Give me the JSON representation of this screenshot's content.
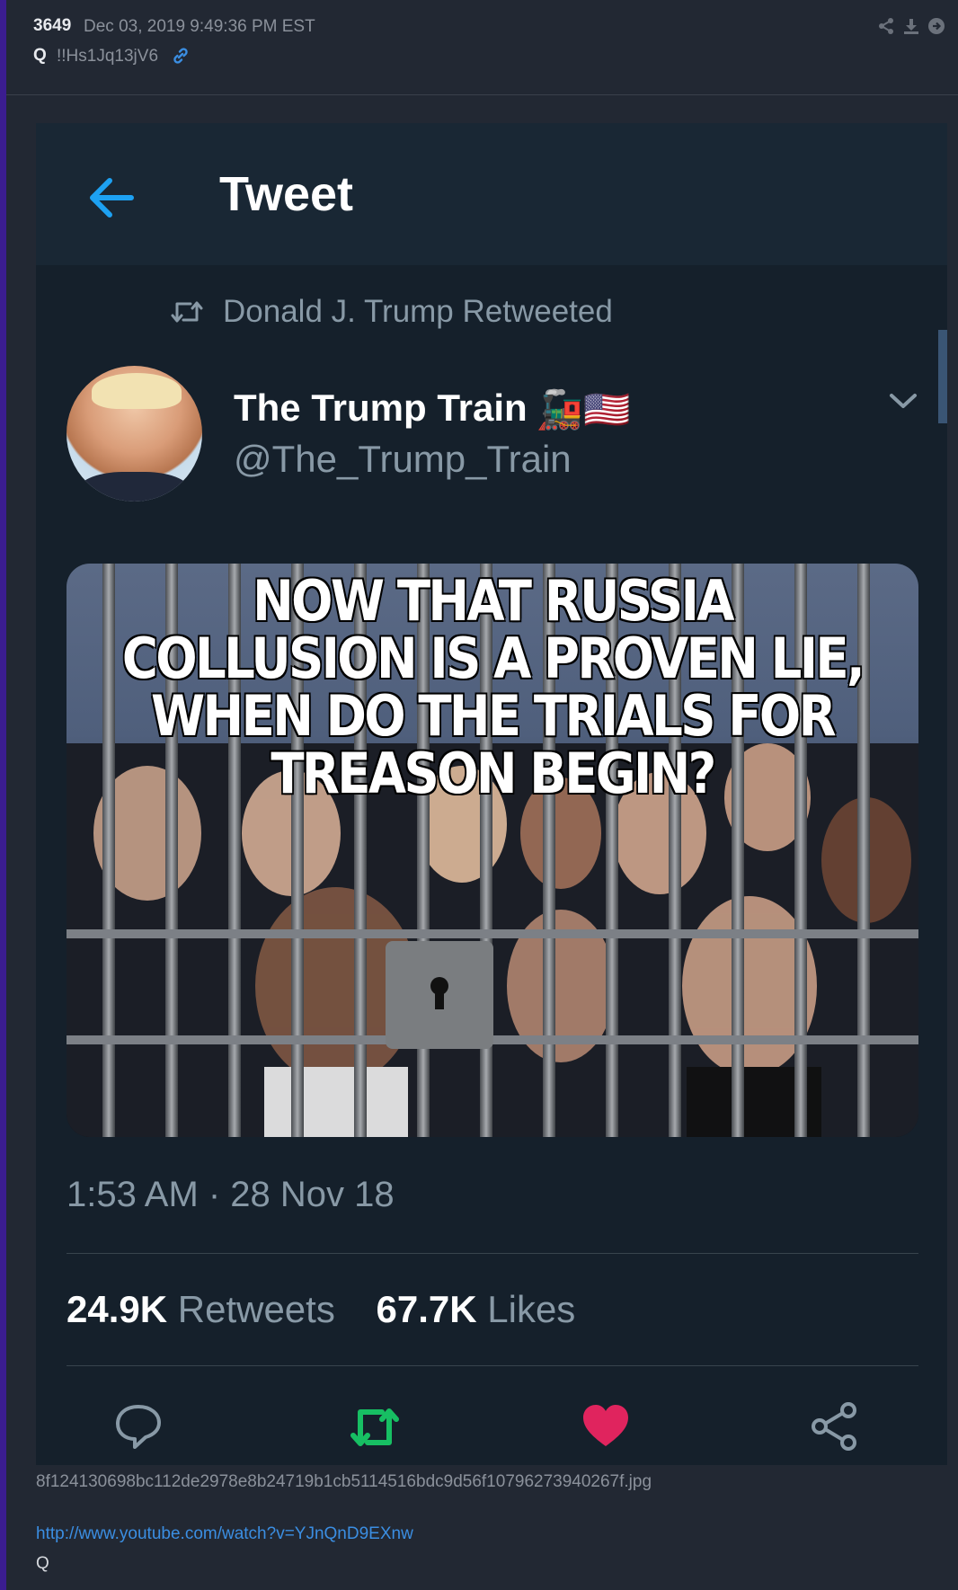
{
  "post": {
    "number": "3649",
    "date": "Dec 03, 2019 9:49:36 PM EST",
    "author": "Q",
    "tripcode": "!!Hs1Jq13jV6"
  },
  "tweet": {
    "header_title": "Tweet",
    "retweeted_by": "Donald J. Trump Retweeted",
    "display_name": "The Trump Train",
    "name_emoji": "🚂🇺🇸",
    "handle": "@The_Trump_Train",
    "image_caption": "NOW THAT RUSSIA COLLUSION IS A PROVEN LIE, WHEN DO THE TRIALS FOR TREASON BEGIN?",
    "timestamp": "1:53 AM · 28 Nov 18",
    "retweets_count": "24.9K",
    "retweets_label": "Retweets",
    "likes_count": "67.7K",
    "likes_label": "Likes"
  },
  "attachment": {
    "filename": "8f124130698bc112de2978e8b24719b1cb5114516bdc9d56f10796273940267f.jpg"
  },
  "body": {
    "link": "http://www.youtube.com/watch?v=YJnQnD9EXnw",
    "signature": "Q"
  },
  "icons": {
    "link": "link-icon",
    "share": "share-icon",
    "download": "download-icon",
    "goto": "arrow-circle-icon",
    "back": "back-arrow-icon",
    "retweet": "retweet-icon",
    "menu": "chevron-down-icon",
    "reply": "reply-icon",
    "like": "heart-icon",
    "share_tweet": "share-icon"
  },
  "colors": {
    "page_bg": "#222833",
    "tweet_bg": "#15202b",
    "accent_blue": "#1da1f2",
    "retweet_green": "#17bf63",
    "like_pink": "#e0245e",
    "link_blue": "#3b8ee2"
  }
}
